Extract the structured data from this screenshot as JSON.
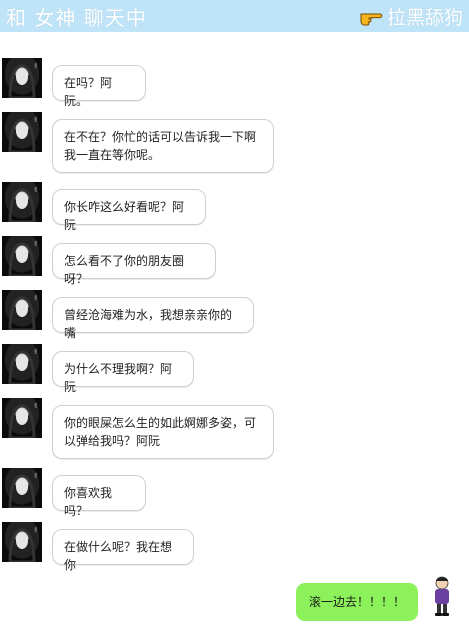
{
  "header": {
    "title": "和 女神 聊天中",
    "block_label": "拉黑舔狗"
  },
  "messages": [
    {
      "text": "在吗？阿阮。"
    },
    {
      "text": "在不在？你忙的话可以告诉我一下啊我一直在等你呢。"
    },
    {
      "text": "你长咋这么好看呢？阿阮"
    },
    {
      "text": "怎么看不了你的朋友圈呀？"
    },
    {
      "text": "曾经沧海难为水，我想亲亲你的嘴"
    },
    {
      "text": "为什么不理我啊？阿阮"
    },
    {
      "text": "你的眼屎怎么生的如此婀娜多姿，可以弹给我吗？阿阮"
    },
    {
      "text": "你喜欢我吗？"
    },
    {
      "text": "在做什么呢？我在想你"
    }
  ],
  "self_message": {
    "text": "滚一边去！！！！"
  },
  "colors": {
    "header_bg": "#bfe3f7",
    "self_bubble": "#8cf15b"
  },
  "icons": {
    "block": "pointing-hand-icon",
    "avatar": "goddess-avatar",
    "self_avatar": "cartoon-man-avatar"
  }
}
